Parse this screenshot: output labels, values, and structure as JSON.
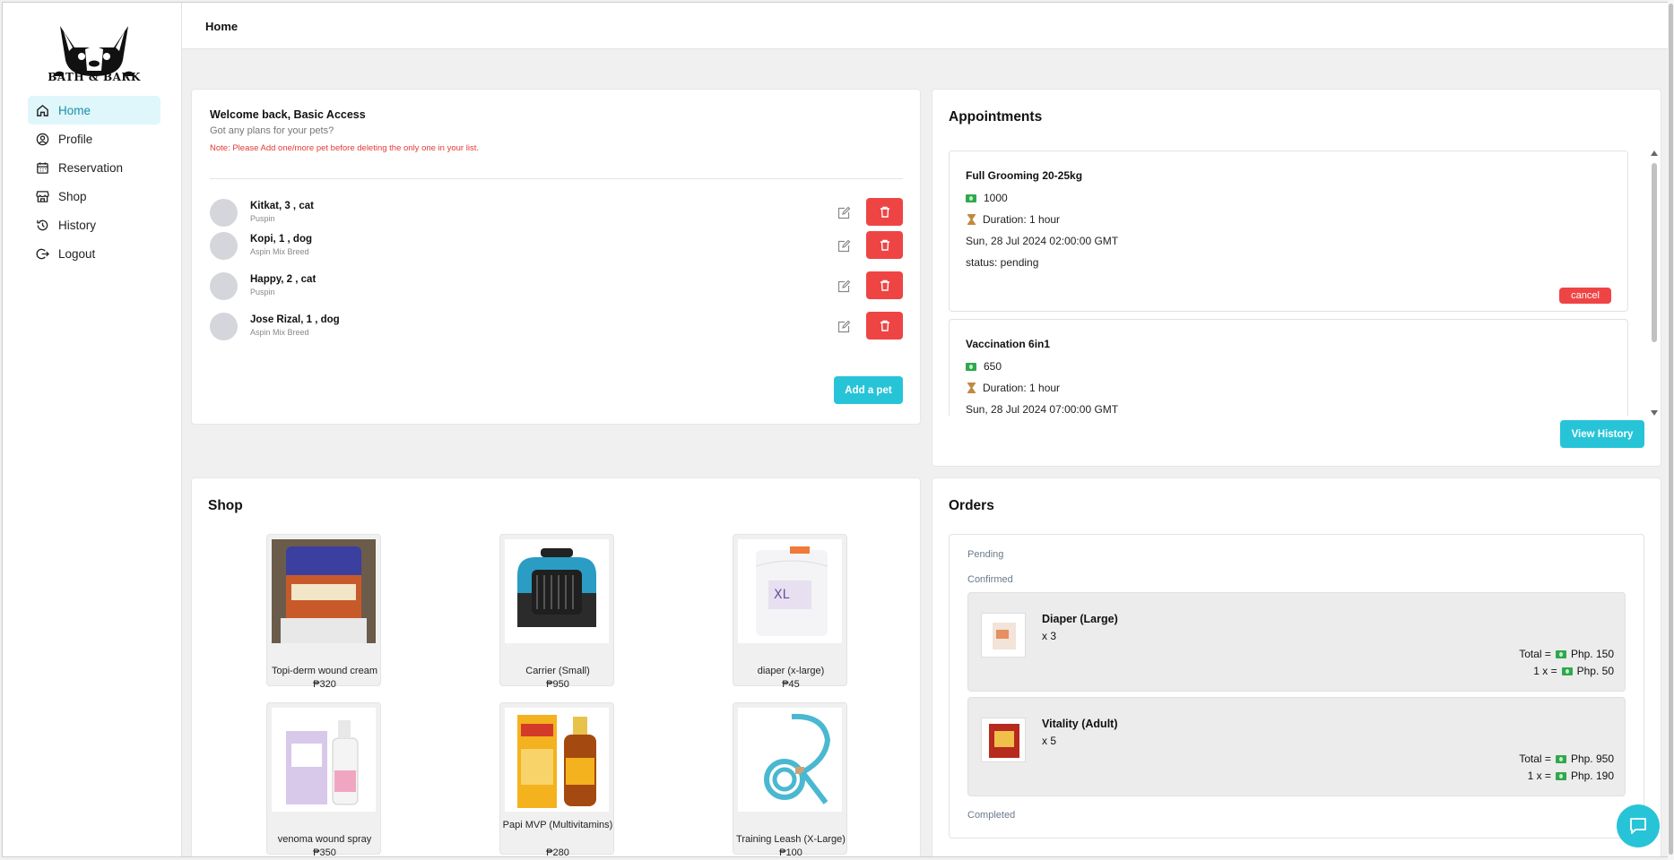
{
  "brand": {
    "name": "BATH & BARK"
  },
  "sidebar": {
    "items": [
      {
        "label": "Home",
        "icon": "home-icon",
        "active": true
      },
      {
        "label": "Profile",
        "icon": "user-circle-icon"
      },
      {
        "label": "Reservation",
        "icon": "calendar-icon"
      },
      {
        "label": "Shop",
        "icon": "store-icon"
      },
      {
        "label": "History",
        "icon": "history-icon"
      },
      {
        "label": "Logout",
        "icon": "logout-icon"
      }
    ]
  },
  "header": {
    "title": "Home"
  },
  "welcome": {
    "title": "Welcome back, Basic Access",
    "subtitle": "Got any plans for your pets?",
    "note": "Note: Please Add one/more pet before deleting the only one in your list.",
    "add_label": "Add a pet",
    "pets": [
      {
        "name": "Kitkat, 3 , cat",
        "breed": "Puspin"
      },
      {
        "name": "Kopi, 1 , dog",
        "breed": "Aspin Mix Breed"
      },
      {
        "name": "Happy, 2 , cat",
        "breed": "Puspin"
      },
      {
        "name": "Jose Rizal, 1 , dog",
        "breed": "Aspin Mix Breed"
      }
    ]
  },
  "appointments": {
    "title": "Appointments",
    "view_history_label": "View History",
    "items": [
      {
        "name": "Full Grooming 20-25kg",
        "price": "1000",
        "duration": "Duration: 1 hour",
        "date": "Sun, 28 Jul 2024 02:00:00 GMT",
        "status": "status: pending",
        "cancel_label": "cancel"
      },
      {
        "name": "Vaccination 6in1",
        "price": "650",
        "duration": "Duration: 1 hour",
        "date": "Sun, 28 Jul 2024 07:00:00 GMT"
      }
    ]
  },
  "shop": {
    "title": "Shop",
    "products": [
      {
        "name": "Topi-derm wound cream",
        "price": "₱320"
      },
      {
        "name": "Carrier (Small)",
        "price": "₱950"
      },
      {
        "name": "diaper (x-large)",
        "price": "₱45"
      },
      {
        "name": "venoma wound spray",
        "price": "₱350"
      },
      {
        "name": "Papi MVP (Multivitamins)",
        "price": "₱280"
      },
      {
        "name": "Training Leash (X-Large)",
        "price": "₱100"
      }
    ]
  },
  "orders": {
    "title": "Orders",
    "pending_label": "Pending",
    "confirmed_label": "Confirmed",
    "completed_label": "Completed",
    "items": [
      {
        "name": "Diaper (Large)",
        "qty": "x 3",
        "total_prefix": "Total =",
        "total": "Php. 150",
        "unit_prefix": "1 x =",
        "unit": "Php. 50"
      },
      {
        "name": "Vitality (Adult)",
        "qty": "x 5",
        "total_prefix": "Total =",
        "total": "Php. 950",
        "unit_prefix": "1 x =",
        "unit": "Php. 190"
      }
    ]
  },
  "colors": {
    "accent": "#27c4d8",
    "danger": "#ef4444",
    "nav_active_bg": "#dff6fb"
  }
}
